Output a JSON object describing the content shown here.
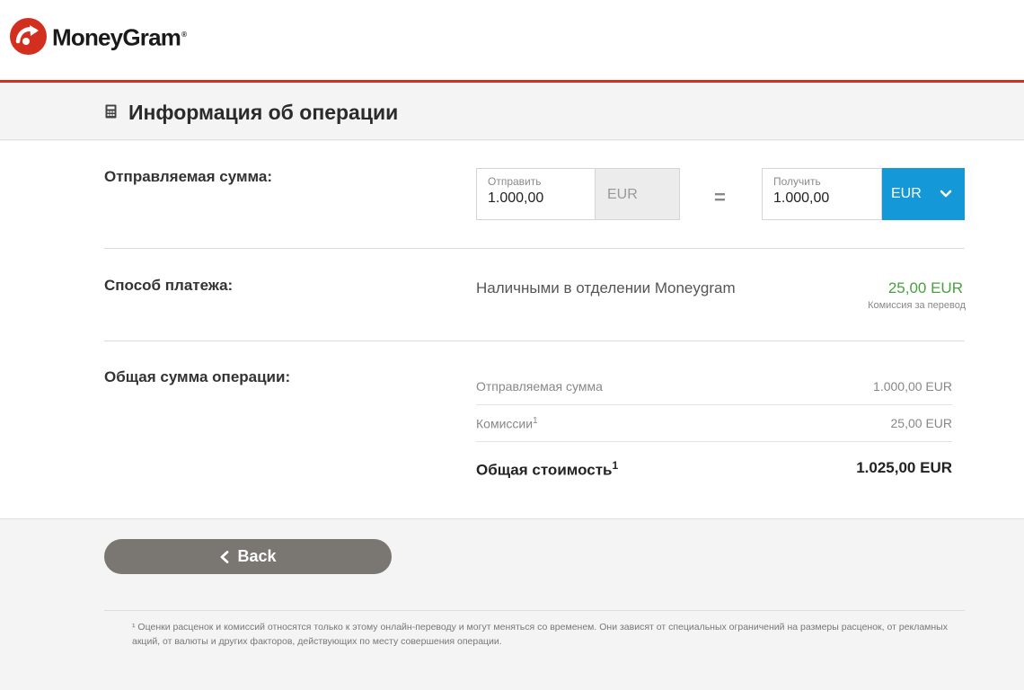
{
  "brand": {
    "name": "MoneyGram",
    "reg_mark": "®",
    "accent_color": "#d32f1f",
    "select_color": "#1598d8",
    "fee_color": "#4aa040"
  },
  "page": {
    "title": "Информация об операции",
    "title_icon": "calculator-icon"
  },
  "amount_section": {
    "label": "Отправляемая сумма:",
    "send": {
      "label": "Отправить",
      "value": "1.000,00",
      "currency": "EUR"
    },
    "equals": "=",
    "receive": {
      "label": "Получить",
      "value": "1.000,00",
      "currency": "EUR"
    }
  },
  "payment_section": {
    "label": "Способ платежа:",
    "method": "Наличными в отделении Moneygram",
    "fee": "25,00 EUR",
    "fee_note": "Комиссия за перевод"
  },
  "total_section": {
    "label": "Общая сумма операции:",
    "rows": [
      {
        "label": "Отправляемая сумма",
        "value": "1.000,00 EUR"
      },
      {
        "label": "Комиссии",
        "sup": "1",
        "value": "25,00 EUR"
      }
    ],
    "total": {
      "label": "Общая стоимость",
      "sup": "1",
      "value": "1.025,00 EUR"
    }
  },
  "actions": {
    "back_label": "Back"
  },
  "footnote": "¹ Оценки расценок и комиссий относятся только к этому онлайн-переводу и могут меняться со временем. Они зависят от специальных ограничений на размеры расценок, от рекламных акций, от валюты и других факторов, действующих по месту совершения операции."
}
